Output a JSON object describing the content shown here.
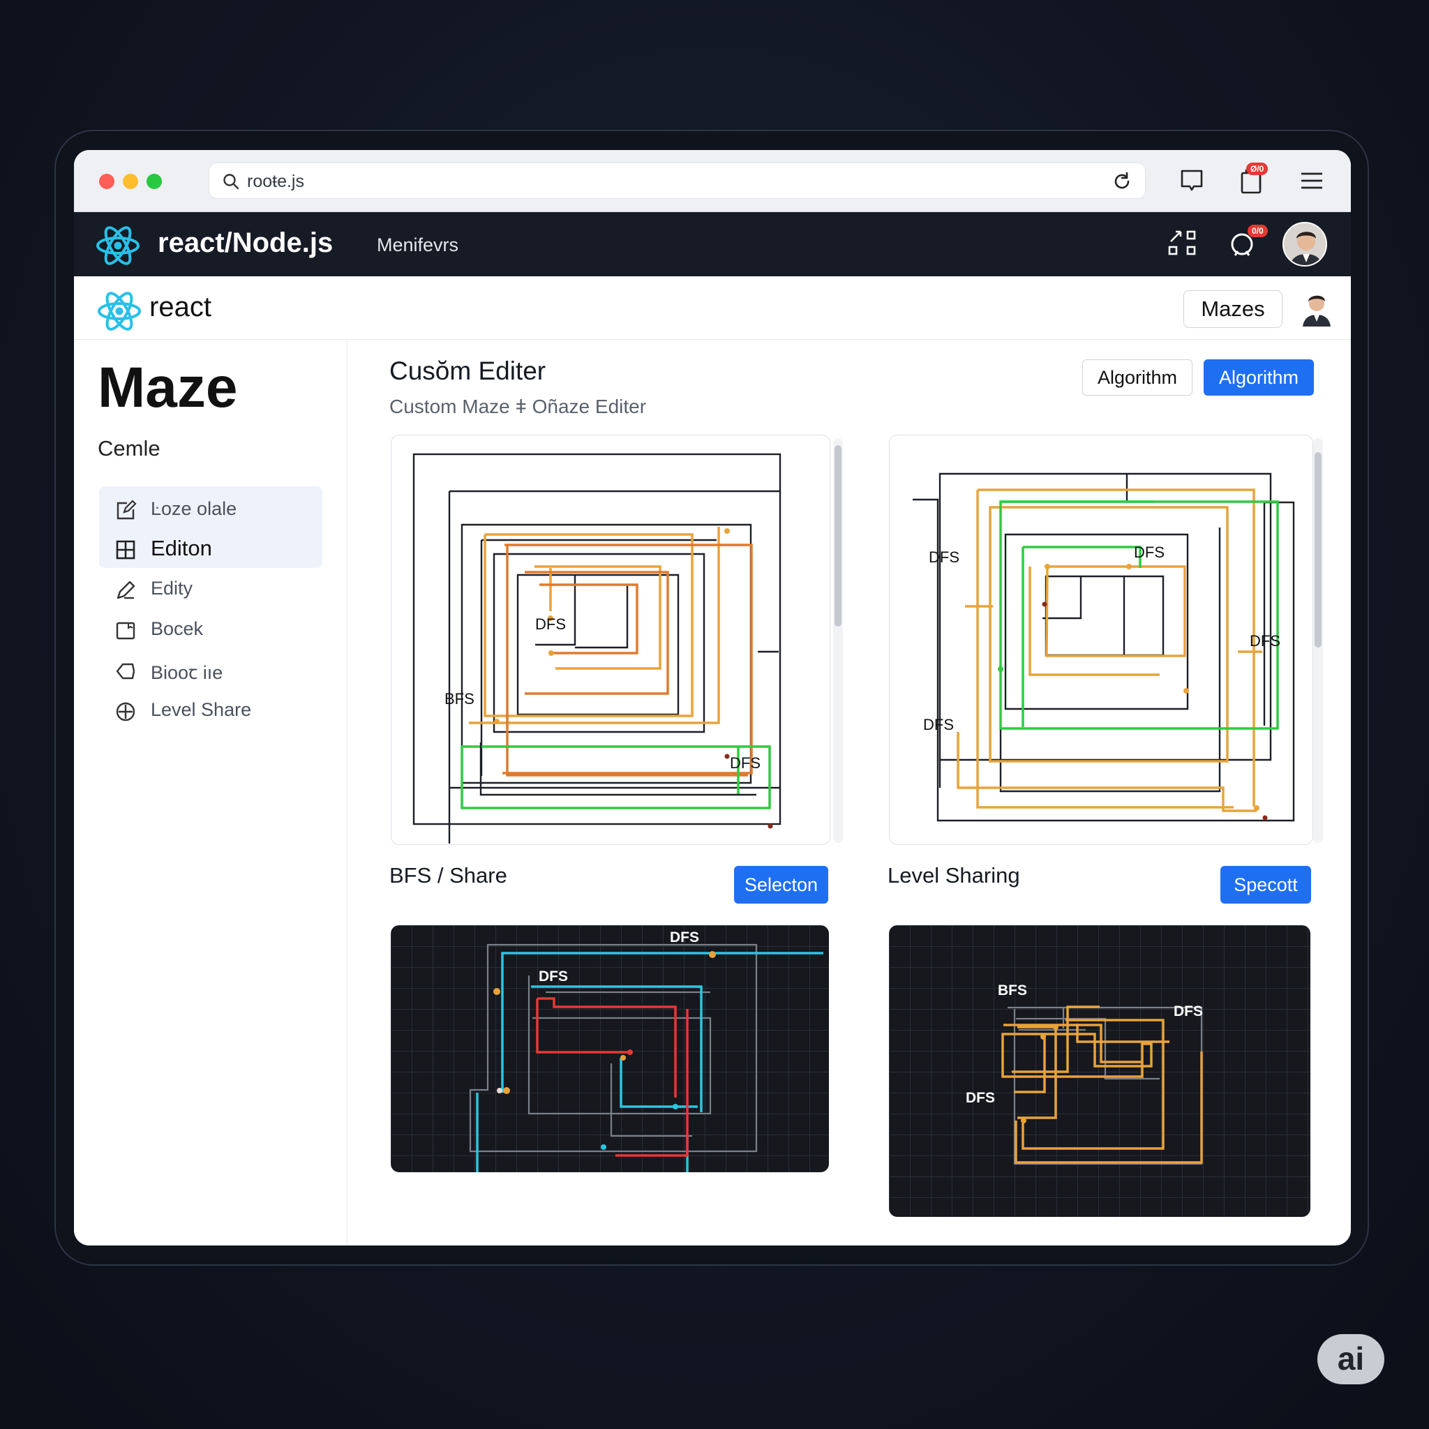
{
  "browser": {
    "url": "rooŧe.js",
    "notification_badge": "Ø/0"
  },
  "topnav": {
    "brand": "react/Node.js",
    "menu_link": "Menifevrs",
    "notification_badge": "0/0"
  },
  "subheader": {
    "brand": "react",
    "mazes_button": "Mazes"
  },
  "sidebar": {
    "title": "Maze",
    "section": "Cemle",
    "items": [
      {
        "label": "Ŀoze olale",
        "icon": "edit-square-icon"
      },
      {
        "label": "Editon",
        "icon": "grid-icon"
      },
      {
        "label": "Edity",
        "icon": "pencil-icon"
      },
      {
        "label": "Bocek",
        "icon": "note-icon"
      },
      {
        "label": "Bіooꞇ iıe",
        "icon": "tag-icon"
      },
      {
        "label": "Level Share",
        "icon": "share-node-icon"
      }
    ]
  },
  "main": {
    "title": "Cusŏm Editer",
    "subtitle": "Custom Maze ǂ Oñaze Editer",
    "algorithm_outline_button": "Algorithm",
    "algorithm_primary_button": "Algorithm"
  },
  "maze_left": {
    "labels": [
      "DFS",
      "BFS",
      "DFS"
    ]
  },
  "maze_right": {
    "labels": [
      "DFS",
      "DFS",
      "DFS",
      "DFS"
    ]
  },
  "cards": {
    "left_title": "BFS / Share",
    "left_button": "Selecton",
    "right_title": "Level Sharing",
    "right_button": "Specott"
  },
  "dark_left": {
    "labels": [
      "DFS",
      "DFS"
    ]
  },
  "dark_right": {
    "labels": [
      "BFS",
      "DFS",
      "DFS"
    ]
  },
  "watermark": "ai",
  "colors": {
    "accent_blue": "#1f6ff2",
    "react_cyan": "#29c0e8",
    "path_orange": "#e8a33a",
    "path_red_orange": "#e07a2e",
    "path_green": "#2ecc40",
    "path_cyan": "#2ac6e0",
    "path_red": "#e53935"
  }
}
